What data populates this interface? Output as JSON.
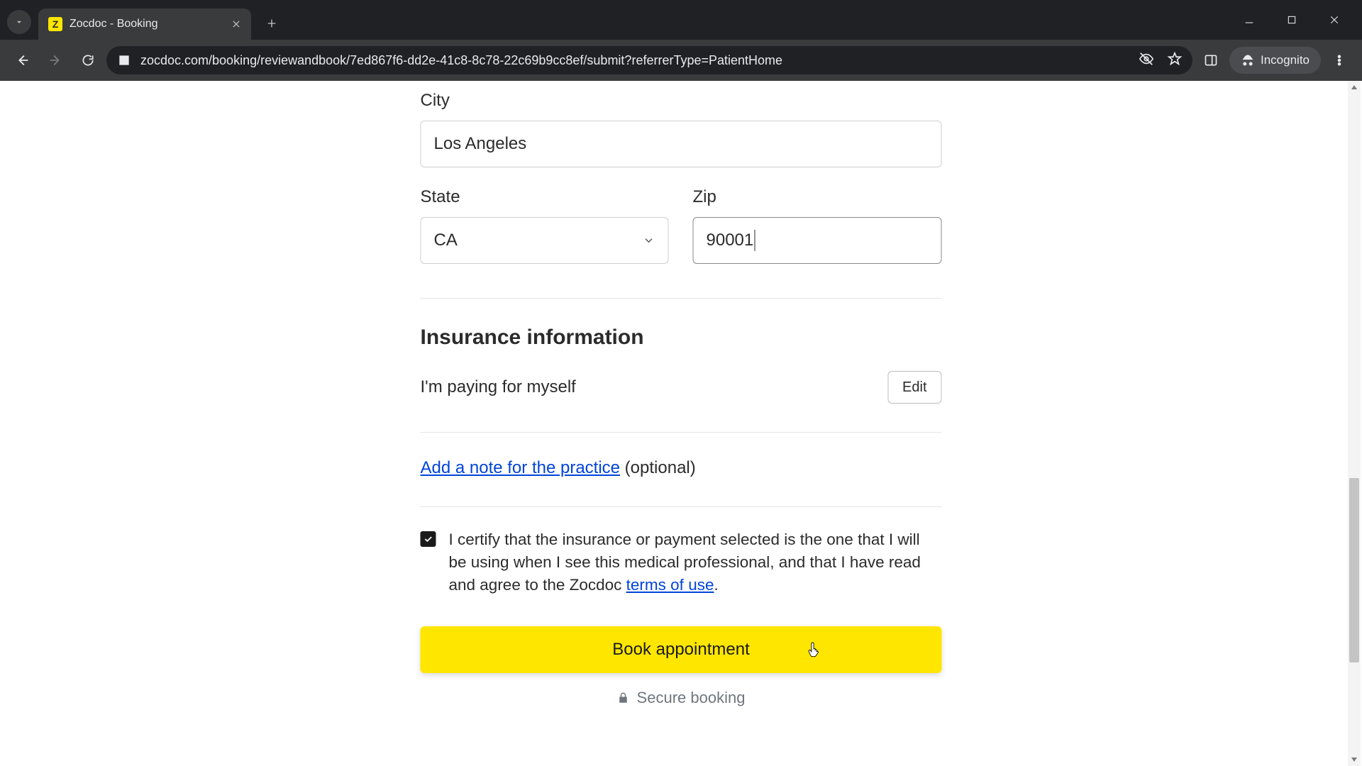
{
  "browser": {
    "tab_title": "Zocdoc - Booking",
    "url": "zocdoc.com/booking/reviewandbook/7ed867f6-dd2e-41c8-8c78-22c69b9cc8ef/submit?referrerType=PatientHome",
    "incognito_label": "Incognito"
  },
  "form": {
    "city_label": "City",
    "city_value": "Los Angeles",
    "state_label": "State",
    "state_value": "CA",
    "zip_label": "Zip",
    "zip_value": "90001"
  },
  "insurance": {
    "heading": "Insurance information",
    "summary": "I'm paying for myself",
    "edit_label": "Edit"
  },
  "note": {
    "link_text": "Add a note for the practice",
    "optional_text": " (optional)"
  },
  "certify": {
    "text_before_link": "I certify that the insurance or payment selected is the one that I will be using when I see this medical professional, and that I have read and agree to the Zocdoc ",
    "link_text": "terms of use",
    "text_after_link": "."
  },
  "actions": {
    "book_label": "Book appointment",
    "secure_label": "Secure booking"
  }
}
